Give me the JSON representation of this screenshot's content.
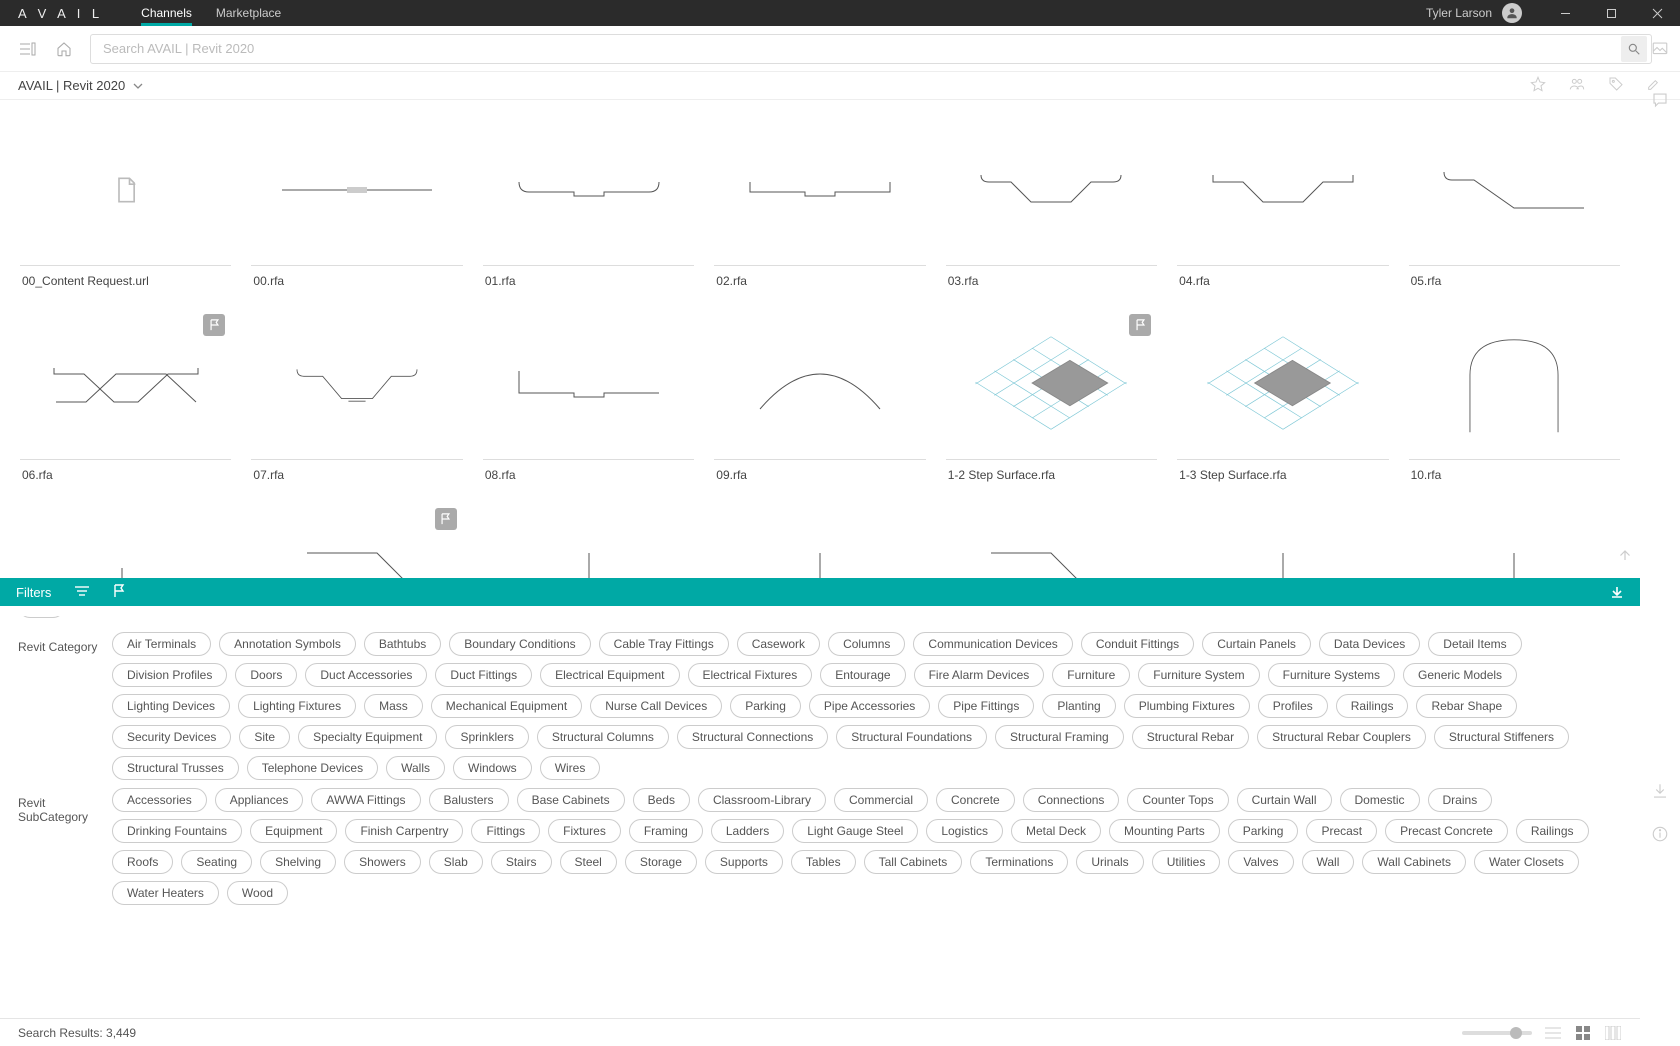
{
  "app": {
    "logo": "A V A I L"
  },
  "nav": {
    "tabs": [
      {
        "label": "Channels",
        "active": true
      },
      {
        "label": "Marketplace",
        "active": false
      }
    ]
  },
  "user": {
    "name": "Tyler Larson"
  },
  "search": {
    "placeholder": "Search AVAIL | Revit 2020"
  },
  "breadcrumb": {
    "path": "AVAIL | Revit 2020"
  },
  "results": {
    "label_prefix": "Search Results: ",
    "count": "3,449"
  },
  "grid": {
    "items": [
      {
        "label": "00_Content Request.url",
        "thumb": "file",
        "flag": false
      },
      {
        "label": "00.rfa",
        "thumb": "p0",
        "flag": false
      },
      {
        "label": "01.rfa",
        "thumb": "p1",
        "flag": false
      },
      {
        "label": "02.rfa",
        "thumb": "p2",
        "flag": false
      },
      {
        "label": "03.rfa",
        "thumb": "p3",
        "flag": false
      },
      {
        "label": "04.rfa",
        "thumb": "p4",
        "flag": false
      },
      {
        "label": "05.rfa",
        "thumb": "p5",
        "flag": false
      },
      {
        "label": "06.rfa",
        "thumb": "p6",
        "flag": true
      },
      {
        "label": "07.rfa",
        "thumb": "p7",
        "flag": false
      },
      {
        "label": "08.rfa",
        "thumb": "p8",
        "flag": false
      },
      {
        "label": "09.rfa",
        "thumb": "p9",
        "flag": false
      },
      {
        "label": "1-2 Step Surface.rfa",
        "thumb": "iso12",
        "flag": true
      },
      {
        "label": "1-3 Step Surface.rfa",
        "thumb": "iso13",
        "flag": false
      },
      {
        "label": "10.rfa",
        "thumb": "p10",
        "flag": false
      }
    ]
  },
  "filters": {
    "title": "Filters",
    "groups": [
      {
        "label": "Revit Category",
        "tags": [
          "Air Terminals",
          "Annotation Symbols",
          "Bathtubs",
          "Boundary Conditions",
          "Cable Tray Fittings",
          "Casework",
          "Columns",
          "Communication Devices",
          "Conduit Fittings",
          "Curtain Panels",
          "Data Devices",
          "Detail Items",
          "Division Profiles",
          "Doors",
          "Duct Accessories",
          "Duct Fittings",
          "Electrical Equipment",
          "Electrical Fixtures",
          "Entourage",
          "Fire Alarm Devices",
          "Furniture",
          "Furniture System",
          "Furniture Systems",
          "Generic Models",
          "Lighting Devices",
          "Lighting Fixtures",
          "Mass",
          "Mechanical Equipment",
          "Nurse Call Devices",
          "Parking",
          "Pipe Accessories",
          "Pipe Fittings",
          "Planting",
          "Plumbing Fixtures",
          "Profiles",
          "Railings",
          "Rebar Shape",
          "Security Devices",
          "Site",
          "Specialty Equipment",
          "Sprinklers",
          "Structural Columns",
          "Structural Connections",
          "Structural Foundations",
          "Structural Framing",
          "Structural Rebar",
          "Structural Rebar Couplers",
          "Structural Stiffeners",
          "Structural Trusses",
          "Telephone Devices",
          "Walls",
          "Windows",
          "Wires"
        ]
      },
      {
        "label": "Revit SubCategory",
        "tags": [
          "Accessories",
          "Appliances",
          "AWWA Fittings",
          "Balusters",
          "Base Cabinets",
          "Beds",
          "Classroom-Library",
          "Commercial",
          "Concrete",
          "Connections",
          "Counter Tops",
          "Curtain Wall",
          "Domestic",
          "Drains",
          "Drinking Fountains",
          "Equipment",
          "Finish Carpentry",
          "Fittings",
          "Fixtures",
          "Framing",
          "Ladders",
          "Light Gauge Steel",
          "Logistics",
          "Metal Deck",
          "Mounting Parts",
          "Parking",
          "Precast",
          "Precast Concrete",
          "Railings",
          "Roofs",
          "Seating",
          "Shelving",
          "Showers",
          "Slab",
          "Stairs",
          "Steel",
          "Storage",
          "Supports",
          "Tables",
          "Tall Cabinets",
          "Terminations",
          "Urinals",
          "Utilities",
          "Valves",
          "Wall",
          "Wall Cabinets",
          "Water Closets",
          "Water Heaters",
          "Wood"
        ]
      }
    ]
  },
  "colors": {
    "accent": "#00a9a5"
  }
}
